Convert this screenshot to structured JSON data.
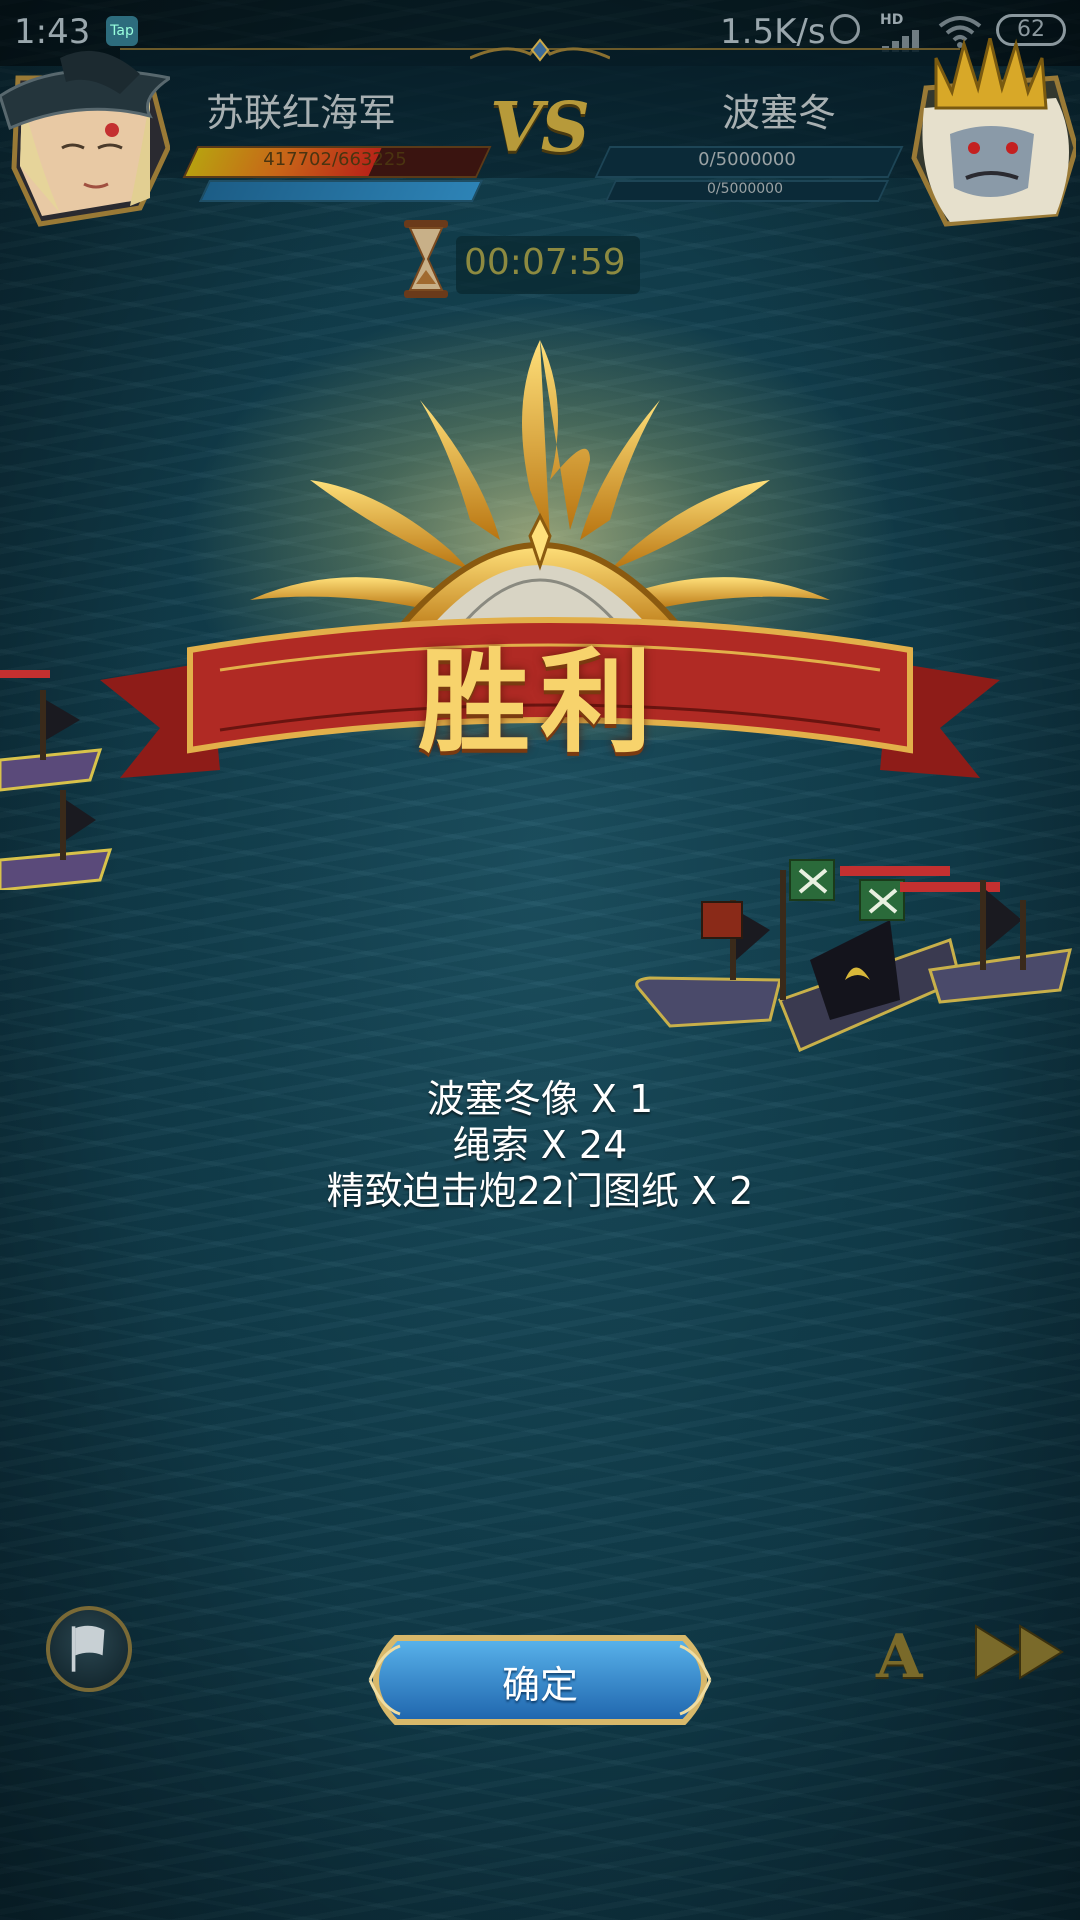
{
  "status_bar": {
    "time": "1:43",
    "app_badge": "Tap",
    "net_speed": "1.5K/s",
    "hd_label": "HD",
    "battery": "62"
  },
  "battle": {
    "player": {
      "name": "苏联红海军",
      "hp_text": "417702/663225",
      "hp_fraction": 0.63,
      "sub_bar_fraction": 1.0
    },
    "opponent": {
      "name": "波塞冬",
      "hp_text": "0/5000000",
      "sub_hp_text": "0/5000000",
      "hp_fraction": 0
    },
    "vs_label": "VS",
    "timer": "00:07:59"
  },
  "result": {
    "title": "胜利",
    "rewards": [
      "波塞冬像 X 1",
      "绳索 X 24",
      "精致迫击炮22门图纸 X 2"
    ]
  },
  "controls": {
    "confirm_label": "确定",
    "auto_label": "A"
  },
  "colors": {
    "sea": "#123f4e",
    "gold": "#f7d36c",
    "banner_red": "#b02a24",
    "button_blue": "#2f86cc"
  }
}
